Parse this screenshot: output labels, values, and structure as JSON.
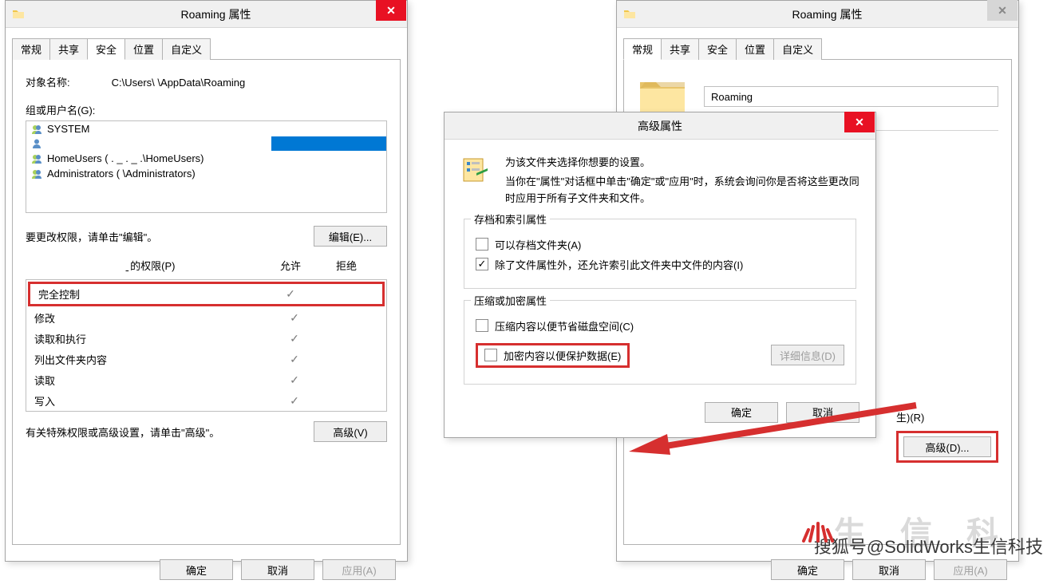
{
  "left": {
    "title": "Roaming 属性",
    "tabs": [
      "常规",
      "共享",
      "安全",
      "位置",
      "自定义"
    ],
    "activeTab": 2,
    "objNameLabel": "对象名称:",
    "objNameValue": "C:\\Users\\              \\AppData\\Roaming",
    "groupOrUser": "组或用户名(G):",
    "users": [
      "SYSTEM",
      "",
      "HomeUsers ( . _ . _ .\\HomeUsers)",
      "Administrators (               \\Administrators)"
    ],
    "editHint": "要更改权限，请单击\"编辑\"。",
    "editBtn": "编辑(E)...",
    "permsLabelSuffix": "的权限(P)",
    "allowHdr": "允许",
    "denyHdr": "拒绝",
    "perms": [
      {
        "name": "完全控制",
        "allow": true,
        "deny": false
      },
      {
        "name": "修改",
        "allow": true,
        "deny": false
      },
      {
        "name": "读取和执行",
        "allow": true,
        "deny": false
      },
      {
        "name": "列出文件夹内容",
        "allow": true,
        "deny": false
      },
      {
        "name": "读取",
        "allow": true,
        "deny": false
      },
      {
        "name": "写入",
        "allow": true,
        "deny": false
      }
    ],
    "advHint": "有关特殊权限或高级设置，请单击\"高级\"。",
    "advBtn": "高级(V)",
    "okBtn": "确定",
    "cancelBtn": "取消",
    "applyBtn": "应用(A)"
  },
  "right": {
    "title": "Roaming 属性",
    "tabs": [
      "常规",
      "共享",
      "安全",
      "位置",
      "自定义"
    ],
    "activeTab": 0,
    "folderName": "Roaming",
    "partialLabel": "生)(R)",
    "advBtn": "高级(D)...",
    "okBtn": "确定",
    "cancelBtn": "取消",
    "applyBtn": "应用(A)"
  },
  "adv": {
    "title": "高级属性",
    "intro1": "为该文件夹选择你想要的设置。",
    "intro2": "当你在\"属性\"对话框中单击\"确定\"或\"应用\"时，系统会询问你是否将这些更改同时应用于所有子文件夹和文件。",
    "group1": "存档和索引属性",
    "chk1": "可以存档文件夹(A)",
    "chk1Checked": false,
    "chk2": "除了文件属性外，还允许索引此文件夹中文件的内容(I)",
    "chk2Checked": true,
    "group2": "压缩或加密属性",
    "chk3": "压缩内容以便节省磁盘空间(C)",
    "chk3Checked": false,
    "chk4": "加密内容以便保护数据(E)",
    "chk4Checked": false,
    "detailsBtn": "详细信息(D)",
    "okBtn": "确定",
    "cancelBtn": "取消"
  },
  "watermark": "搜狐号@SolidWorks生信科技",
  "watermarkGray": "生 信 科"
}
